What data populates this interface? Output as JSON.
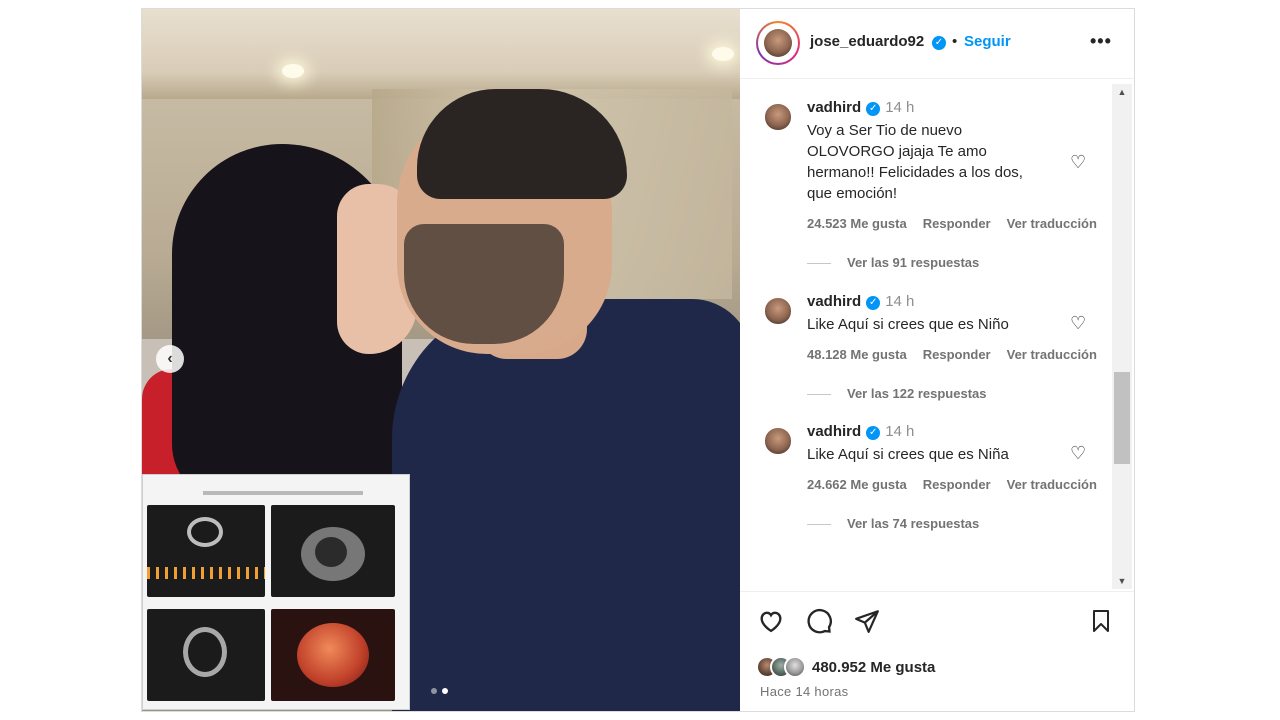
{
  "post": {
    "author": "jose_eduardo92",
    "follow_label": "Seguir",
    "separator": "•",
    "more_label": "•••",
    "carousel": {
      "current_slide": 2,
      "total_slides": 2
    }
  },
  "comments": [
    {
      "user": "vadhird",
      "time": "14 h",
      "text": "Voy a Ser Tio de nuevo OLOVORGO jajaja Te amo hermano!! Felicidades a los dos, que emoción!",
      "likes": "24.523 Me gusta",
      "reply_label": "Responder",
      "translate_label": "Ver traducción",
      "view_replies": "Ver las 91 respuestas"
    },
    {
      "user": "vadhird",
      "time": "14 h",
      "text": "Like Aquí si crees que es Niño",
      "likes": "48.128 Me gusta",
      "reply_label": "Responder",
      "translate_label": "Ver traducción",
      "view_replies": "Ver las 122 respuestas"
    },
    {
      "user": "vadhird",
      "time": "14 h",
      "text": "Like Aquí si crees que es Niña",
      "likes": "24.662 Me gusta",
      "reply_label": "Responder",
      "translate_label": "Ver traducción",
      "view_replies": "Ver las 74 respuestas"
    }
  ],
  "footer": {
    "likes_count": "480.952 Me gusta",
    "time_ago": "Hace 14 horas"
  },
  "icons": {
    "like": "heart-icon",
    "comment": "comment-icon",
    "share": "share-icon",
    "save": "bookmark-icon",
    "prev": "chevron-left-icon",
    "verified": "verified-badge-icon"
  },
  "colors": {
    "accent": "#0095f6",
    "text": "#262626",
    "muted": "#737373"
  }
}
